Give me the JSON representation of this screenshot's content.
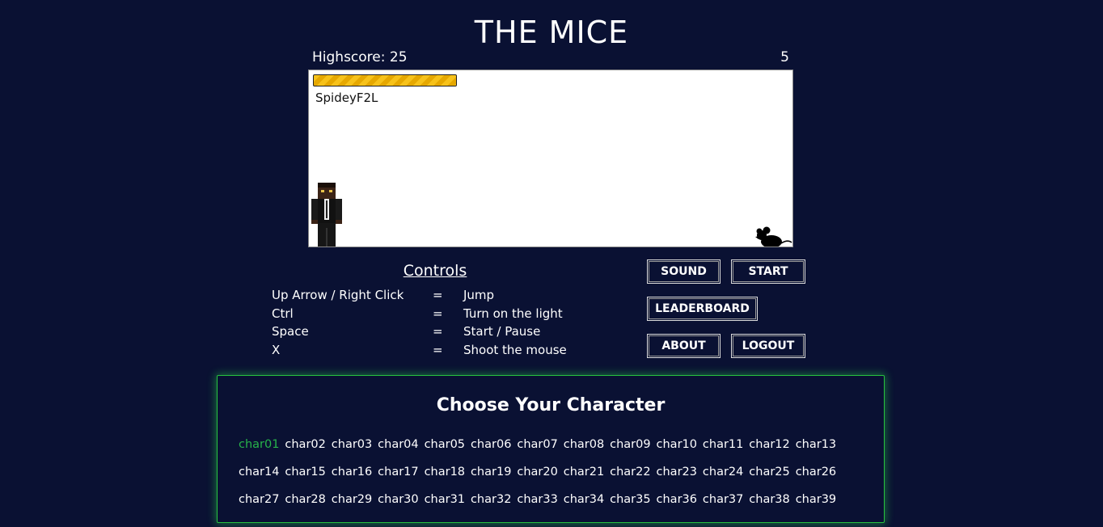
{
  "app": {
    "title": "THE MICE"
  },
  "scoreboard": {
    "highscore_label": "Highscore: 25",
    "current_score": "5"
  },
  "game": {
    "player_name": "SpideyF2L",
    "health_fraction": 1.0
  },
  "controls": {
    "title": "Controls",
    "rows": [
      {
        "key": "Up Arrow / Right Click",
        "eq": "=",
        "action": "Jump"
      },
      {
        "key": "Ctrl",
        "eq": "=",
        "action": "Turn on the light"
      },
      {
        "key": "Space",
        "eq": "=",
        "action": "Start / Pause"
      },
      {
        "key": "X",
        "eq": "=",
        "action": "Shoot the mouse"
      }
    ]
  },
  "buttons": {
    "sound": "SOUND",
    "start": "START",
    "leaderboard": "LEADERBOARD",
    "about": "ABOUT",
    "logout": "LOGOUT"
  },
  "chooser": {
    "title": "Choose Your Character",
    "selected": "char01",
    "characters": [
      "char01",
      "char02",
      "char03",
      "char04",
      "char05",
      "char06",
      "char07",
      "char08",
      "char09",
      "char10",
      "char11",
      "char12",
      "char13",
      "char14",
      "char15",
      "char16",
      "char17",
      "char18",
      "char19",
      "char20",
      "char21",
      "char22",
      "char23",
      "char24",
      "char25",
      "char26",
      "char27",
      "char28",
      "char29",
      "char30",
      "char31",
      "char32",
      "char33",
      "char34",
      "char35",
      "char36",
      "char37",
      "char38",
      "char39"
    ]
  },
  "colors": {
    "background": "#0a1133",
    "accent_green": "#27b34a",
    "health_yellow": "#f7c21a"
  },
  "icons": {
    "enemy": "mouse-silhouette-icon",
    "player": "player-sprite"
  }
}
